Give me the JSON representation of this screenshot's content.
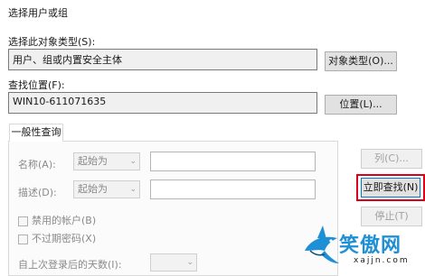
{
  "dialog": {
    "title": "选择用户或组",
    "object_type_label": "选择此对象类型(S):",
    "object_type_value": "用户、组或内置安全主体",
    "object_type_button": "对象类型(O)...",
    "location_label": "查找位置(F):",
    "location_value": "WIN10-611071635",
    "location_button": "位置(L)..."
  },
  "tabs": [
    {
      "label": "一般性查询"
    }
  ],
  "query": {
    "name_label": "名称(A):",
    "name_mode": "起始为",
    "desc_label": "描述(D):",
    "desc_mode": "起始为",
    "disabled_accounts": "禁用的帐户(B)",
    "no_expire_pwd": "不过期密码(X)",
    "days_since_login": "自上次登录后的天数(I):"
  },
  "side_buttons": {
    "columns": "列(C)...",
    "find_now": "立即查找(N)",
    "stop": "停止(T)"
  },
  "watermark": {
    "text": "笑傲网",
    "url": "xajjn.com"
  },
  "colors": {
    "highlight": "#d9001b",
    "logo_blue": "#1f8fd6"
  }
}
